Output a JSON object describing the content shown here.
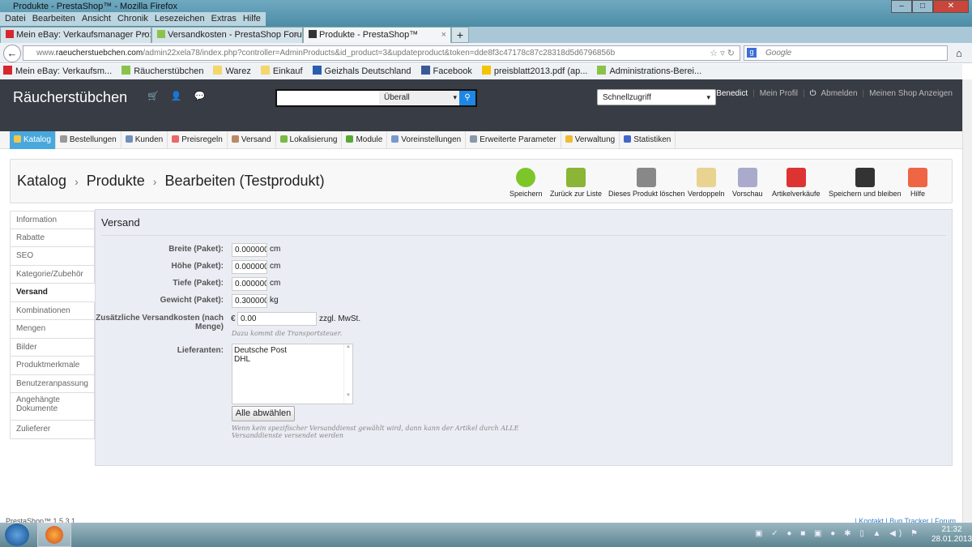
{
  "window": {
    "title": "Produkte - PrestaShop™ - Mozilla Firefox",
    "min": "–",
    "max": "□",
    "close": "✕"
  },
  "menubar": [
    "Datei",
    "Bearbeiten",
    "Ansicht",
    "Chronik",
    "Lesezeichen",
    "Extras",
    "Hilfe"
  ],
  "tabs": [
    {
      "label": "Mein eBay: Verkaufsmanager Pro: Üb...",
      "color": "#d7262e"
    },
    {
      "label": "Versandkosten - PrestaShop Forums",
      "color": "#8bc34a"
    },
    {
      "label": "Produkte - PrestaShop™",
      "color": "#333333"
    }
  ],
  "newtab": "+",
  "url": {
    "pre": "www.",
    "domain": "raeucherstuebchen.com",
    "path": "/admin22xela78/index.php?controller=AdminProducts&id_product=3&updateproduct&token=dde8f3c47178c87c28318d5d6796856b",
    "icons": "☆ ▿ ↻"
  },
  "search_engine": {
    "placeholder": "Google",
    "logo": "g"
  },
  "bookmarks": [
    {
      "label": "Mein eBay: Verkaufsm...",
      "color": "#d7262e"
    },
    {
      "label": "Räucherstübchen",
      "color": "#8bc34a"
    },
    {
      "label": "Warez",
      "color": "#f3d76b"
    },
    {
      "label": "Einkauf",
      "color": "#f3d76b"
    },
    {
      "label": "Geizhals Deutschland",
      "color": "#2a5db0"
    },
    {
      "label": "Facebook",
      "color": "#3b5998"
    },
    {
      "label": "preisblatt2013.pdf (ap...",
      "color": "#f5c400"
    },
    {
      "label": "Administrations-Berei...",
      "color": "#8bc34a"
    }
  ],
  "header": {
    "shop_name": "Räucherstübchen",
    "icons": "🛒 👤 💬",
    "search_scope": "Überall",
    "search_icon": "⚲",
    "quick_access": "Schnellzugriff",
    "user": "A Benedict",
    "profile": "Mein Profil",
    "logout": "Abmelden",
    "view_shop": "Meinen Shop Anzeigen"
  },
  "menu": [
    {
      "label": "Katalog",
      "color": "#f3c64b"
    },
    {
      "label": "Bestellungen",
      "color": "#999"
    },
    {
      "label": "Kunden",
      "color": "#6f8fbf"
    },
    {
      "label": "Preisregeln",
      "color": "#e66"
    },
    {
      "label": "Versand",
      "color": "#b86"
    },
    {
      "label": "Lokalisierung",
      "color": "#7b4"
    },
    {
      "label": "Module",
      "color": "#5a3"
    },
    {
      "label": "Voreinstellungen",
      "color": "#79c"
    },
    {
      "label": "Erweiterte Parameter",
      "color": "#89a"
    },
    {
      "label": "Verwaltung",
      "color": "#eb3"
    },
    {
      "label": "Statistiken",
      "color": "#46c"
    }
  ],
  "breadcrumb": [
    "Katalog",
    "Produkte",
    "Bearbeiten (Testprodukt)"
  ],
  "crumb_sep": "›",
  "toolbar": [
    {
      "label": "Speichern",
      "color": "#7cc62a"
    },
    {
      "label": "Zurück zur Liste",
      "color": "#8ab536"
    },
    {
      "label": "Dieses Produkt löschen",
      "color": "#888"
    },
    {
      "label": "Verdoppeln",
      "color": "#e9d391"
    },
    {
      "label": "Vorschau",
      "color": "#aac"
    },
    {
      "label": "Artikelverkäufe",
      "color": "#d33"
    },
    {
      "label": "Speichern und bleiben",
      "color": "#333"
    },
    {
      "label": "Hilfe",
      "color": "#e64"
    }
  ],
  "sidebar": [
    "Information",
    "Rabatte",
    "SEO",
    "Kategorie/Zubehör",
    "Versand",
    "Kombinationen",
    "Mengen",
    "Bilder",
    "Produktmerkmale",
    "Benutzeranpassung",
    "Angehängte Dokumente",
    "Zulieferer"
  ],
  "form": {
    "title": "Versand",
    "fields": [
      {
        "label": "Breite (Paket):",
        "value": "0.000000",
        "unit": "cm"
      },
      {
        "label": "Höhe (Paket):",
        "value": "0.000000",
        "unit": "cm"
      },
      {
        "label": "Tiefe (Paket):",
        "value": "0.000000",
        "unit": "cm"
      },
      {
        "label": "Gewicht (Paket):",
        "value": "0.300000",
        "unit": "kg"
      }
    ],
    "extra_label_1": "Zusätzliche Versandkosten (nach",
    "extra_label_2": "Menge)",
    "currency": "€",
    "extra_value": "0.00",
    "extra_unit": "zzgl. MwSt.",
    "extra_hint": "Dazu kommt die Transportsteuer.",
    "carriers_label": "Lieferanten:",
    "carriers": [
      "Deutsche Post",
      "DHL"
    ],
    "deselect": "Alle abwählen",
    "carriers_hint_1": "Wenn kein spezifischer Versanddienst gewählt wird, dann kann der Artikel durch ALLE",
    "carriers_hint_2": "Versanddienste versendet werden"
  },
  "footer": {
    "version": "PrestaShop™ 1.5.3.1",
    "links": "| Kontakt | Bug Tracker | Forum"
  },
  "taskbar": {
    "time": "21:32",
    "date": "28.01.2013",
    "tray": "▣ ✓ ● ■ ▣ ● ✱ ▯ ▲ ◀) ⚑"
  }
}
